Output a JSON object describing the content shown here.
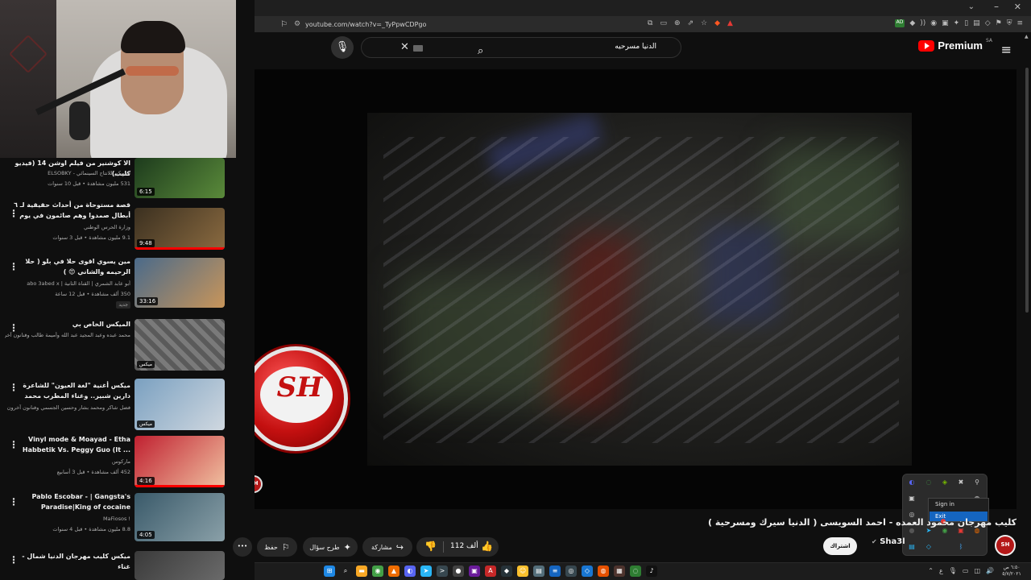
{
  "browser": {
    "url": "youtube.com/watch?v=_TyPpwCDPgo",
    "bookmark_icon": "bookmark-icon",
    "window_controls": [
      "chevron-down-icon",
      "minimize-icon",
      "close-icon"
    ]
  },
  "header": {
    "logo_text": "Premium",
    "logo_region": "SA",
    "search_query": "الدنيا مسرحيه",
    "clear_glyph": "✕",
    "search_glyph": "⌕",
    "mic_glyph": "🎙",
    "menu_glyph": "≡"
  },
  "sidebar": {
    "items": [
      {
        "title": "الا كوشنير من فيلم اوشن 14 (فيديو كليب)",
        "channel": "السبكي للانتاج السينمائي - ELSOBKY",
        "meta": "531 مليون مشاهدة • قبل 10 سنوات",
        "duration": "6:15",
        "thumb_colors": [
          "#1d3b1d",
          "#5a8a3a"
        ]
      },
      {
        "title": "قصة مستوحاة من أحداث حقيقية لـ ٦ أبطال صمدوا وهم صائمون في يوم #عشرة_واحد...",
        "channel": "وزارة الحرس الوطني",
        "meta": "9.1 مليون مشاهدة • قبل 3 سنوات",
        "duration": "9:48",
        "thumb_colors": [
          "#3b3020",
          "#8a6a40"
        ]
      },
      {
        "title": "مين يسوي اقوى حلا في بلو ( حلا الرحيمه والشاني 😍 )",
        "channel": "أبو عابد الشمري | القناة الثانية | abo 3abed x",
        "meta": "350 ألف مشاهدة • قبل 12 ساعة",
        "duration": "33:16",
        "badge": "جديد",
        "thumb_colors": [
          "#4a6a8a",
          "#c8955a"
        ]
      },
      {
        "title": "الميكس الخاص بي",
        "channel": "محمد عبده وعبد المجيد عبد الله وأميمة طالب وفنانون آخرون",
        "meta": "",
        "duration": "ميكس",
        "thumb_colors": [
          "#5a5a5a",
          "#8a8a8a"
        ]
      },
      {
        "title": "ميكس أغنية \"لغة العيون\" للشاعرة دارين شبير.. وغناء المطرب محمد بشار",
        "channel": "فضل شاكر ومحمد بشار وحسين الجسمي وفنانون آخرون",
        "meta": "",
        "duration": "ميكس",
        "thumb_colors": [
          "#7aa0c0",
          "#d0d8e0"
        ]
      },
      {
        "title": "Vinyl mode & Moayad - Etha Habbetik Vs. Peggy Guo (It ...",
        "channel": "ماركوس",
        "meta": "452 ألف مشاهدة • قبل 3 أسابيع",
        "duration": "4:16",
        "thumb_colors": [
          "#c02030",
          "#f0c0a0"
        ]
      },
      {
        "title": "Pablo Escobar - | Gangsta's Paradise|King of cocaine",
        "channel": "MaFiosos !",
        "meta": "8.8 مليون مشاهدة • قبل 4 سنوات",
        "duration": "4:05",
        "thumb_colors": [
          "#3a5a6a",
          "#8aa0a8"
        ]
      },
      {
        "title": "ميكس كليب مهرجان الدنيا شمال - غناء",
        "channel": "",
        "meta": "",
        "duration": "",
        "thumb_colors": [
          "#3a3a3a",
          "#6a6a6a"
        ]
      }
    ]
  },
  "player": {
    "watermark_text": "SH",
    "watermark_small": "SH"
  },
  "tray_menu": {
    "signin_label": "Sign in",
    "exit_label": "Exit"
  },
  "video": {
    "title": "كليب مهرجان محمود العمده - احمد السويسى ( الدنيا سيرك ومسرحية )",
    "channel_name": "Sha3l",
    "channel_avatar_text": "SH",
    "subscribe_label": "اشتراك",
    "likes": "112 ألف",
    "share_label": "مشاركة",
    "ask_label": "طرح سؤال",
    "save_label": "حفظ",
    "more_glyph": "•••"
  },
  "taskbar": {
    "apps": [
      {
        "icon": "windows-icon",
        "color": "#1e88e5",
        "glyph": "⊞"
      },
      {
        "icon": "search-icon",
        "color": "#1c1c1c",
        "glyph": "⌕"
      },
      {
        "icon": "files-icon",
        "color": "#f9a825",
        "glyph": "▬"
      },
      {
        "icon": "chrome-icon",
        "color": "#43a047",
        "glyph": "◉"
      },
      {
        "icon": "brave-icon",
        "color": "#ef6c00",
        "glyph": "▲"
      },
      {
        "icon": "discord-icon",
        "color": "#5865f2",
        "glyph": "◐"
      },
      {
        "icon": "telegram-icon",
        "color": "#29b6f6",
        "glyph": "➤"
      },
      {
        "icon": "terminal-icon",
        "color": "#37474f",
        "glyph": ">"
      },
      {
        "icon": "obs-icon",
        "color": "#424242",
        "glyph": "●"
      },
      {
        "icon": "photo-icon",
        "color": "#6a1b9a",
        "glyph": "▣"
      },
      {
        "icon": "affinity-icon",
        "color": "#c62828",
        "glyph": "A"
      },
      {
        "icon": "app-icon",
        "color": "#263238",
        "glyph": "◆"
      },
      {
        "icon": "emoji-icon",
        "color": "#fbc02d",
        "glyph": "☺"
      },
      {
        "icon": "folder-icon",
        "color": "#546e7a",
        "glyph": "▤"
      },
      {
        "icon": "vscode-icon",
        "color": "#1565c0",
        "glyph": "≡"
      },
      {
        "icon": "steam-icon",
        "color": "#37474f",
        "glyph": "◎"
      },
      {
        "icon": "app2-icon",
        "color": "#1976d2",
        "glyph": "◇"
      },
      {
        "icon": "firefox-icon",
        "color": "#e65100",
        "glyph": "◍"
      },
      {
        "icon": "app3-icon",
        "color": "#4e342e",
        "glyph": "▦"
      },
      {
        "icon": "whatsapp-icon",
        "color": "#2e7d32",
        "glyph": "◌"
      },
      {
        "icon": "tiktok-icon",
        "color": "#111111",
        "glyph": "♪"
      }
    ],
    "clock_time": "٦:٥٠ ص",
    "clock_date": "٥/٧/٢٠٢١"
  }
}
